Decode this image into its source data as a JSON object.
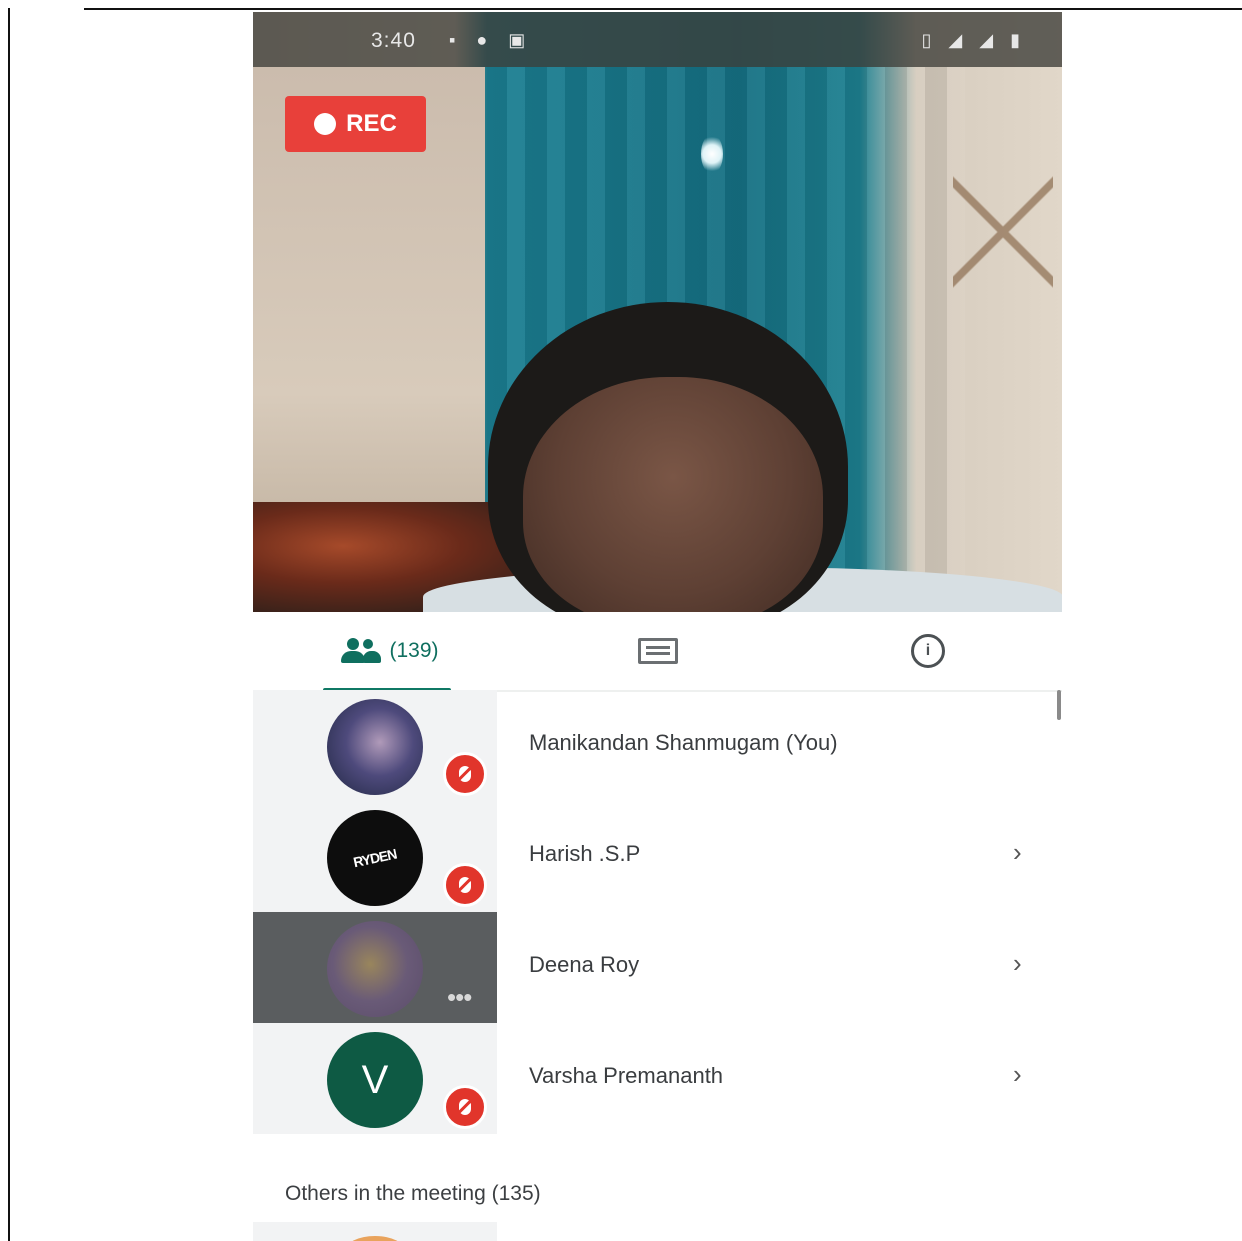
{
  "status_bar": {
    "time": "3:40",
    "left_icons": "▪ ● ▣",
    "right_icons": "▯ ◢ ◢ ▮"
  },
  "recording": {
    "label": "REC"
  },
  "tabs": {
    "people": {
      "count_label": "(139)",
      "icon": "people-icon",
      "active": true
    },
    "chat": {
      "icon": "chat-icon"
    },
    "info": {
      "icon": "info-icon",
      "glyph": "i"
    }
  },
  "participants": [
    {
      "name": "Manikandan Shanmugam (You)",
      "muted": true,
      "chevron": ""
    },
    {
      "name": "Harish .S.P",
      "muted": true,
      "chevron": "›",
      "avatar_text": "RYDEN"
    },
    {
      "name": "Deena Roy",
      "muted": false,
      "speaking": true,
      "chevron": "›",
      "more": "•••"
    },
    {
      "name": "Varsha Premananth",
      "muted": true,
      "chevron": "›",
      "initial": "V"
    }
  ],
  "others_section": {
    "label": "Others in the meeting (135)"
  },
  "colors": {
    "accent": "#0f7864",
    "rec_red": "#e8403a",
    "mute_red": "#e1352b",
    "avatar_green": "#0e5a44"
  }
}
